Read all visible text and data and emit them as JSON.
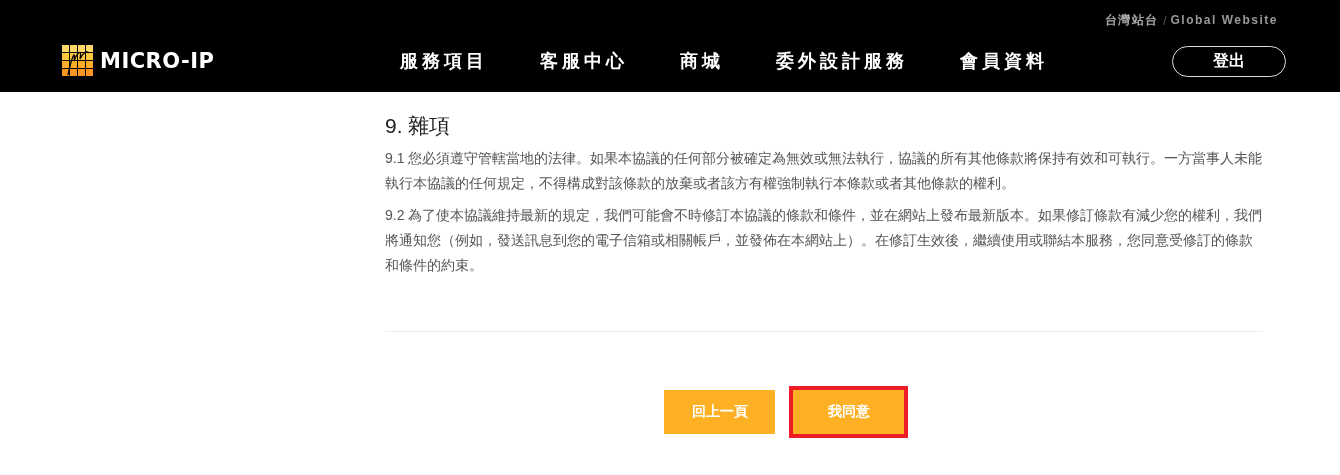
{
  "header": {
    "site_links": [
      {
        "label": "台灣站台",
        "selected": true
      },
      {
        "label": "Global Website",
        "selected": false
      }
    ],
    "separator": "/",
    "logo": {
      "text": "MICRO-IP"
    },
    "nav": [
      {
        "label": "服務項目"
      },
      {
        "label": "客服中心"
      },
      {
        "label": "商城"
      },
      {
        "label": "委外設計服務"
      },
      {
        "label": "會員資料"
      }
    ],
    "logout": "登出"
  },
  "section": {
    "title": "9. 雜項",
    "paragraphs": [
      "9.1 您必須遵守管轄當地的法律。如果本協議的任何部分被確定為無效或無法執行，協議的所有其他條款將保持有效和可執行。一方當事人未能執行本協議的任何規定，不得構成對該條款的放棄或者該方有權強制執行本條款或者其他條款的權利。",
      "9.2 為了使本協議維持最新的規定，我們可能會不時修訂本協議的條款和條件，並在網站上發布最新版本。如果修訂條款有減少您的權利，我們將通知您（例如，發送訊息到您的電子信箱或相關帳戶，並發佈在本網站上）。在修訂生效後，繼續使用或聯結本服務，您同意受修訂的條款和條件的約束。"
    ]
  },
  "buttons": [
    {
      "label": "回上一頁",
      "highlighted": false
    },
    {
      "label": "我同意",
      "highlighted": true
    }
  ]
}
